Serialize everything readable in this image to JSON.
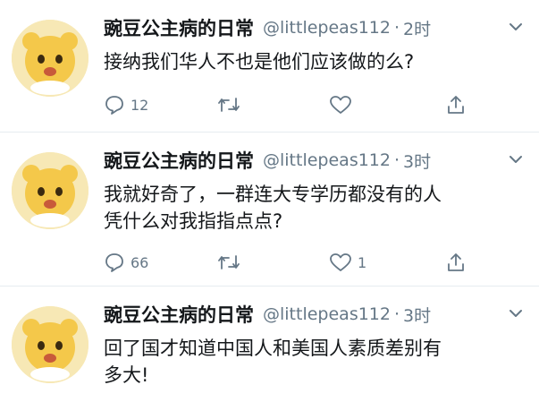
{
  "tweets": [
    {
      "name": "豌豆公主病的日常",
      "handle": "@littlepeas112",
      "dot": "·",
      "time": "2时",
      "lines": [
        "接纳我们华人不也是他们应该做的么?"
      ],
      "replies": "12",
      "retweets": "",
      "likes": ""
    },
    {
      "name": "豌豆公主病的日常",
      "handle": "@littlepeas112",
      "dot": "·",
      "time": "3时",
      "lines": [
        "我就好奇了，一群连大专学历都没有的人",
        "凭什么对我指指点点?"
      ],
      "replies": "66",
      "retweets": "",
      "likes": "1"
    },
    {
      "name": "豌豆公主病的日常",
      "handle": "@littlepeas112",
      "dot": "·",
      "time": "3时",
      "lines": [
        "回了国才知道中国人和美国人素质差别有",
        "多大!"
      ],
      "replies": "",
      "retweets": "",
      "likes": ""
    }
  ],
  "icons": {
    "reply": "speech-bubble-icon",
    "retweet": "retweet-icon",
    "like": "heart-icon",
    "share": "share-icon",
    "menu": "chevron-down-icon"
  },
  "colors": {
    "icon": "#657786",
    "text": "#14171a",
    "divider": "#e6ecf0"
  }
}
